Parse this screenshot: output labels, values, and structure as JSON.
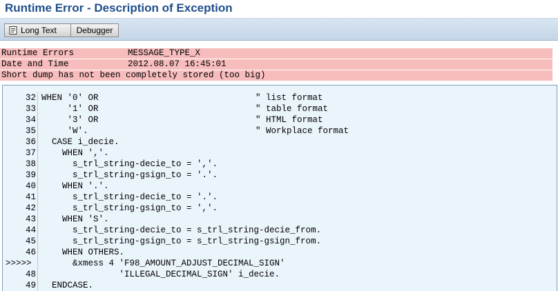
{
  "window": {
    "title": "Runtime Error - Description of Exception"
  },
  "toolbar": {
    "long_text_label": "Long Text",
    "debugger_label": "Debugger",
    "long_text_icon": "scroll-icon"
  },
  "header": {
    "rows": [
      {
        "label": "Runtime Errors",
        "value": "MESSAGE_TYPE_X"
      },
      {
        "label": "Date and Time",
        "value": "2012.08.07 16:45:01"
      },
      {
        "label": "Short dump has not been completely stored (too big)",
        "value": ""
      }
    ]
  },
  "colors": {
    "title": "#1f4e8a",
    "header_row_bg": "#f7bcbc",
    "code_bg": "#eaf4fb",
    "toolbar_bg": "#c3d5e8"
  },
  "code": {
    "lines": [
      {
        "num": "32",
        "code": "WHEN '0' OR",
        "comment": "\" list format"
      },
      {
        "num": "33",
        "code": "     '1' OR",
        "comment": "\" table format"
      },
      {
        "num": "34",
        "code": "     '3' OR",
        "comment": "\" HTML format"
      },
      {
        "num": "35",
        "code": "     'W'.",
        "comment": "\" Workplace format"
      },
      {
        "num": "36",
        "code": "  CASE i_decie.",
        "comment": ""
      },
      {
        "num": "37",
        "code": "    WHEN ','.",
        "comment": ""
      },
      {
        "num": "38",
        "code": "      s_trl_string-decie_to = ','.",
        "comment": ""
      },
      {
        "num": "39",
        "code": "      s_trl_string-gsign_to = '.'.",
        "comment": ""
      },
      {
        "num": "40",
        "code": "    WHEN '.'.",
        "comment": ""
      },
      {
        "num": "41",
        "code": "      s_trl_string-decie_to = '.'.",
        "comment": ""
      },
      {
        "num": "42",
        "code": "      s_trl_string-gsign_to = ','.",
        "comment": ""
      },
      {
        "num": "43",
        "code": "    WHEN 'S'.",
        "comment": ""
      },
      {
        "num": "44",
        "code": "      s_trl_string-decie_to = s_trl_string-decie_from.",
        "comment": ""
      },
      {
        "num": "45",
        "code": "      s_trl_string-gsign_to = s_trl_string-gsign_from.",
        "comment": ""
      },
      {
        "num": "46",
        "code": "    WHEN OTHERS.",
        "comment": ""
      },
      {
        "num": ">>>>>",
        "code": "      &xmess 4 'F98_AMOUNT_ADJUST_DECIMAL_SIGN'",
        "comment": ""
      },
      {
        "num": "48",
        "code": "               'ILLEGAL_DECIMAL_SIGN' i_decie.",
        "comment": ""
      },
      {
        "num": "49",
        "code": "  ENDCASE.",
        "comment": ""
      }
    ]
  }
}
